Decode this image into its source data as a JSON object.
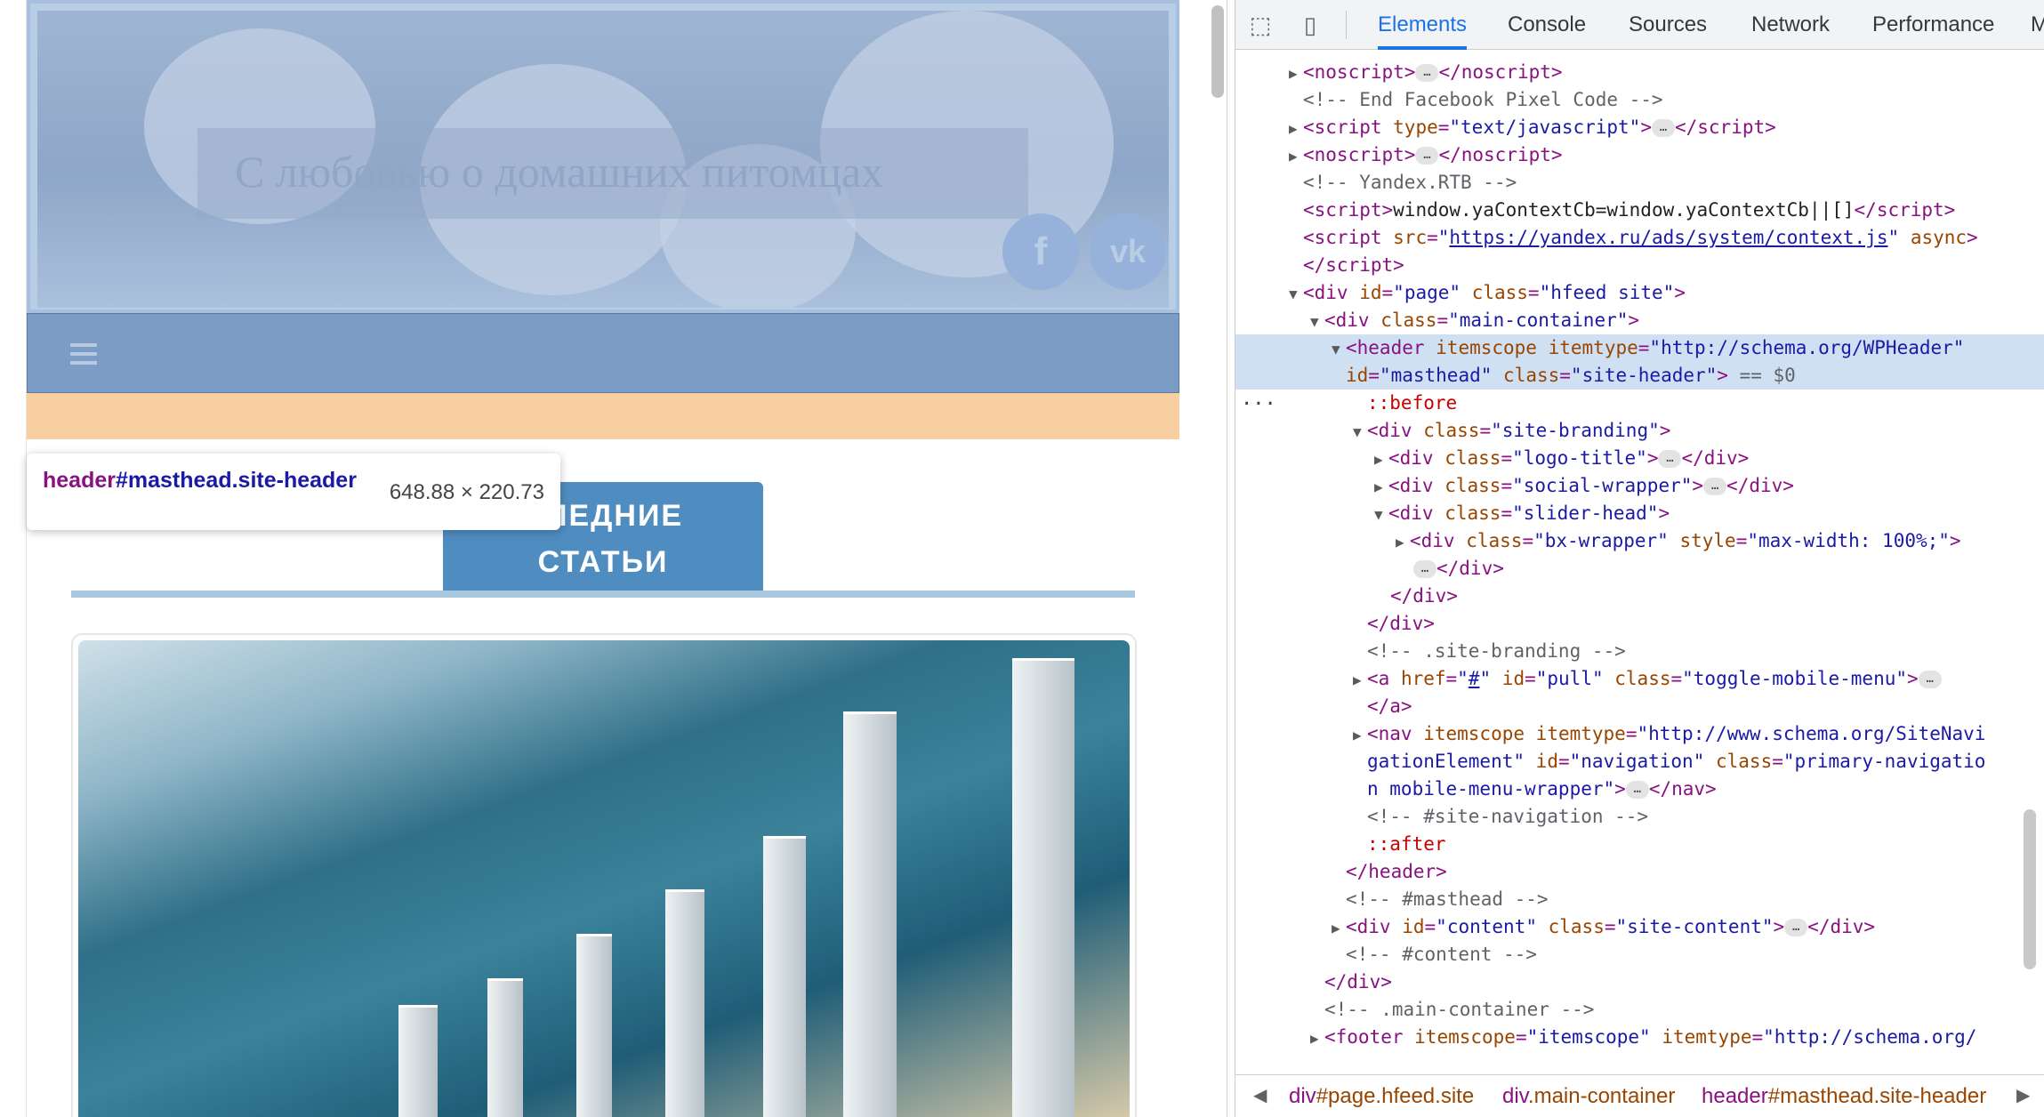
{
  "site": {
    "logo_title": "С любовью о домашних питомцах",
    "social": [
      {
        "icon": "facebook-icon",
        "glyph": "f"
      },
      {
        "icon": "vk-icon",
        "glyph": "vk"
      }
    ],
    "recent_label": "ПОСЛЕДНИЕ СТАТЬИ",
    "recent_line1": "СЛЕДНИЕ",
    "recent_line2": "СТАТЬИ"
  },
  "inspect_tooltip": {
    "tag": "header",
    "id_class": "#masthead.site-header",
    "dimensions": "648.88 × 220.73"
  },
  "devtools": {
    "tabs": [
      "Elements",
      "Console",
      "Sources",
      "Network",
      "Performance",
      "M"
    ],
    "active_tab": "Elements",
    "breadcrumbs": [
      {
        "tag": "div",
        "rest": "#page.hfeed.site"
      },
      {
        "tag": "div",
        "rest": ".main-container"
      },
      {
        "tag": "header",
        "rest": "#masthead.site-header"
      }
    ]
  },
  "colors": {
    "devtools_accent": "#1a73e8",
    "selected_row": "#cfe0f3",
    "tag": "#881280",
    "attr_name": "#994500",
    "attr_value": "#1a1aa6"
  }
}
